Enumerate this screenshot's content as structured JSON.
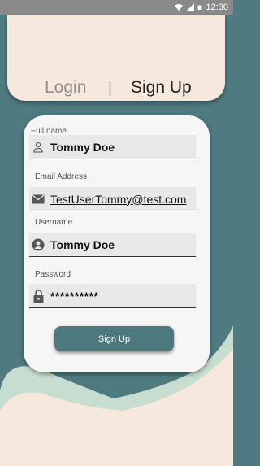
{
  "status_bar": {
    "time": "12:30"
  },
  "tabs": {
    "login": "Login",
    "separator": "|",
    "signup": "Sign Up"
  },
  "form": {
    "full_name": {
      "label": "Full name",
      "value": "Tommy Doe",
      "icon": "person-outline-icon"
    },
    "email": {
      "label": "Email Address",
      "value": "TestUserTommy@test.com",
      "icon": "mail-icon"
    },
    "username": {
      "label": "Username",
      "value": "Tommy Doe",
      "icon": "account-circle-icon"
    },
    "password": {
      "label": "Password",
      "value": "**********",
      "icon": "lock-icon"
    },
    "submit_label": "Sign Up"
  },
  "colors": {
    "background": "#4f7a80",
    "header": "#f7e8dd",
    "wave_light": "#c7ddd0",
    "wave_cream": "#f7e8dd",
    "button": "#4d787e"
  }
}
